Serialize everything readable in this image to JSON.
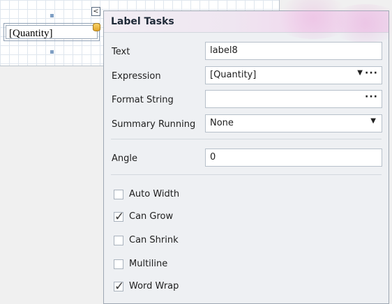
{
  "designer": {
    "control_text": "[Quantity]",
    "collapse_glyph": "<"
  },
  "panel": {
    "title": "Label Tasks",
    "text": {
      "label": "Text",
      "value": "label8"
    },
    "expression": {
      "label": "Expression",
      "value": "[Quantity]",
      "dropdown": "▼",
      "ellipsis": "···"
    },
    "format_string": {
      "label": "Format String",
      "value": "",
      "ellipsis": "···"
    },
    "summary_running": {
      "label": "Summary Running",
      "value": "None",
      "dropdown": "▼"
    },
    "angle": {
      "label": "Angle",
      "value": "0"
    },
    "checks": [
      {
        "label": "Auto Width",
        "checked": false
      },
      {
        "label": "Can Grow",
        "checked": true
      },
      {
        "label": "Can Shrink",
        "checked": false
      },
      {
        "label": "Multiline",
        "checked": false
      },
      {
        "label": "Word Wrap",
        "checked": true
      }
    ]
  },
  "glyphs": {
    "tick": "✓"
  },
  "colors": {
    "panel_bg": "#eef0f3",
    "border": "#9da7b3",
    "header_accent": "#eed6ec"
  }
}
